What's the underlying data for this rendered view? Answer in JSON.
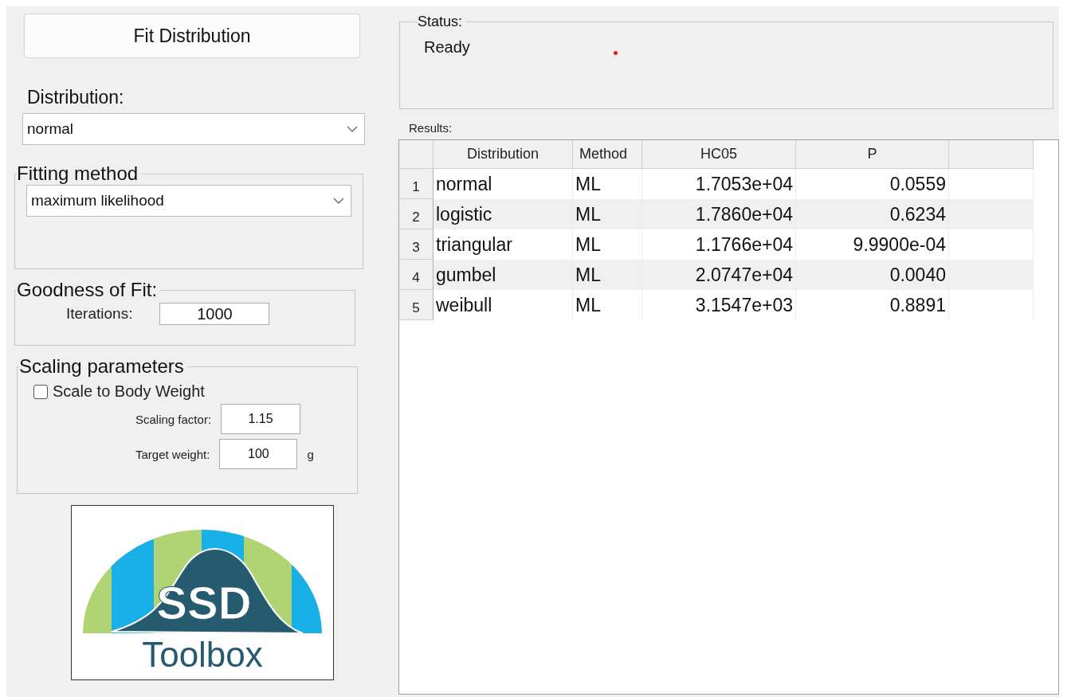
{
  "fit_button": "Fit Distribution",
  "distribution": {
    "label": "Distribution:",
    "value": "normal"
  },
  "fitting_method": {
    "title": "Fitting method",
    "value": "maximum likelihood"
  },
  "goodness_of_fit": {
    "title": "Goodness of Fit:",
    "iterations_label": "Iterations:",
    "iterations": "1000"
  },
  "scaling": {
    "title": "Scaling parameters",
    "checkbox": {
      "label": "Scale to Body Weight",
      "checked": false
    },
    "factor_label": "Scaling factor:",
    "factor": "1.15",
    "weight_label": "Target weight:",
    "weight": "100",
    "weight_unit": "g"
  },
  "logo": {
    "line1": "SSD",
    "line2": "Toolbox"
  },
  "status": {
    "title": "Status:",
    "text": "Ready"
  },
  "results": {
    "label": "Results:",
    "columns": [
      "Distribution",
      "Method",
      "HC05",
      "P"
    ],
    "rows": [
      {
        "index": "1",
        "cells": [
          "normal",
          "ML",
          "1.7053e+04",
          "0.0559"
        ]
      },
      {
        "index": "2",
        "cells": [
          "logistic",
          "ML",
          "1.7860e+04",
          "0.6234"
        ]
      },
      {
        "index": "3",
        "cells": [
          "triangular",
          "ML",
          "1.1766e+04",
          "9.9900e-04"
        ]
      },
      {
        "index": "4",
        "cells": [
          "gumbel",
          "ML",
          "2.0747e+04",
          "0.0040"
        ]
      },
      {
        "index": "5",
        "cells": [
          "weibull",
          "ML",
          "3.1547e+03",
          "0.8891"
        ]
      }
    ]
  }
}
